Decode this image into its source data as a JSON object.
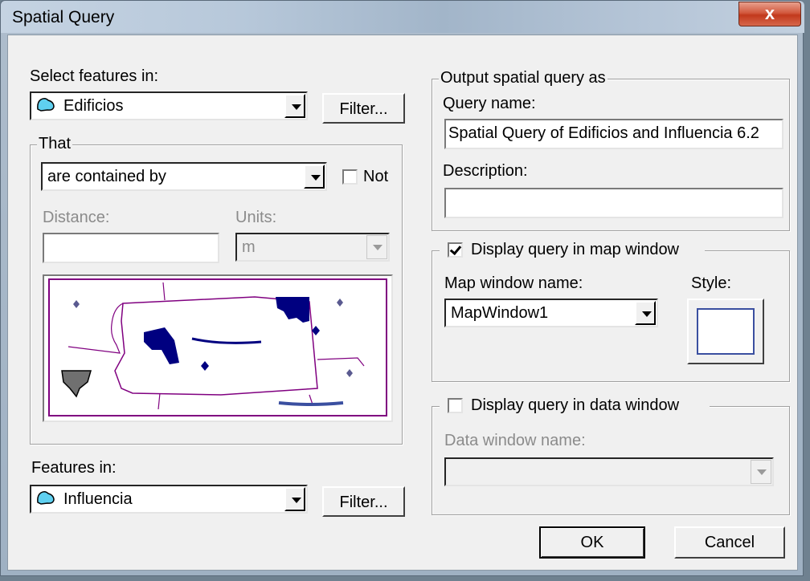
{
  "window": {
    "title": "Spatial Query",
    "close_glyph": "x"
  },
  "select_features": {
    "label": "Select features in:",
    "layer_value": "Edificios",
    "filter_label": "Filter..."
  },
  "that": {
    "group_title": "That",
    "relation_value": "are contained by",
    "not_label": "Not",
    "not_checked": false,
    "distance_label": "Distance:",
    "distance_value": "",
    "units_label": "Units:",
    "units_value": "m"
  },
  "features_in": {
    "label": "Features in:",
    "layer_value": "Influencia",
    "filter_label": "Filter..."
  },
  "output": {
    "group_title": "Output spatial query as",
    "query_name_label": "Query name:",
    "query_name_value": "Spatial Query of Edificios and Influencia 6.2",
    "description_label": "Description:",
    "description_value": ""
  },
  "map_window": {
    "checkbox_label": "Display query in map window",
    "checked": true,
    "name_label": "Map window name:",
    "name_value": "MapWindow1",
    "style_label": "Style:"
  },
  "data_window": {
    "checkbox_label": "Display query in data window",
    "checked": false,
    "name_label": "Data window name:",
    "name_value": ""
  },
  "buttons": {
    "ok": "OK",
    "cancel": "Cancel"
  },
  "colors": {
    "polygon_fill": "#000080",
    "boundary": "#800080",
    "gray_feature": "#707070",
    "accent_blue": "#3a4fa0"
  },
  "icons": {
    "layer": "polygon-layer-icon"
  }
}
